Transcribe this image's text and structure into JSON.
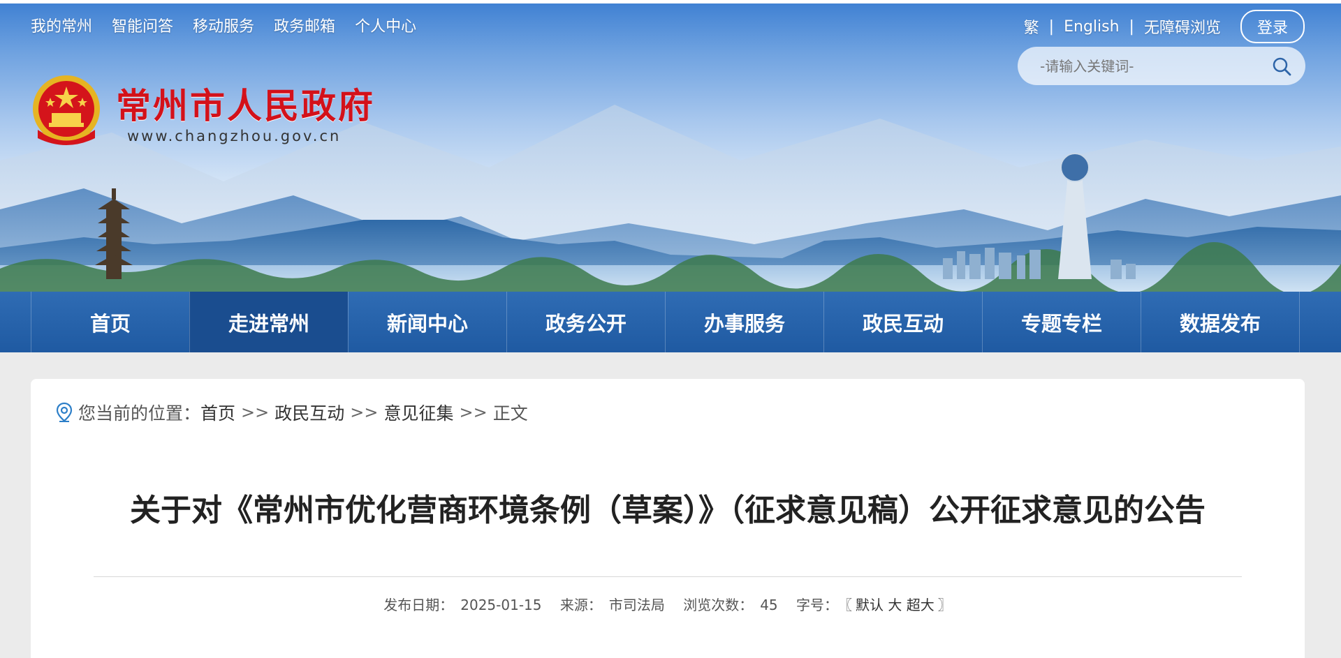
{
  "top_links": [
    "我的常州",
    "智能问答",
    "移动服务",
    "政务邮箱",
    "个人中心"
  ],
  "right_links": {
    "traditional": "繁",
    "english": "English",
    "accessibility": "无障碍浏览",
    "separator": "|",
    "login": "登录"
  },
  "search": {
    "placeholder": "-请输入关键词-"
  },
  "site": {
    "title": "常州市人民政府",
    "url": "www.changzhou.gov.cn"
  },
  "nav": {
    "items": [
      "首页",
      "走进常州",
      "新闻中心",
      "政务公开",
      "办事服务",
      "政民互动",
      "专题专栏",
      "数据发布"
    ],
    "active": "走进常州"
  },
  "breadcrumb": {
    "prefix": "您当前的位置：",
    "items": [
      "首页",
      "政民互动",
      "意见征集",
      "正文"
    ],
    "separator": ">>"
  },
  "article": {
    "title": "关于对《常州市优化营商环境条例（草案）》（征求意见稿）公开征求意见的公告",
    "date_label": "发布日期：",
    "date": "2025-01-15",
    "source_label": "来源：",
    "source": "市司法局",
    "views_label": "浏览次数：",
    "views": "45",
    "font_label": "字号：",
    "font_open": "〖",
    "font_default": "默认",
    "font_large": "大",
    "font_xlarge": "超大",
    "font_close": "〗"
  },
  "colors": {
    "nav_bg": "#1f5aa2",
    "nav_active": "#1a4d8f",
    "title_red": "#d3111a",
    "page_bg": "#ebebeb"
  },
  "icons": {
    "search": "search-icon",
    "location": "location-pin-icon",
    "emblem": "national-emblem"
  }
}
